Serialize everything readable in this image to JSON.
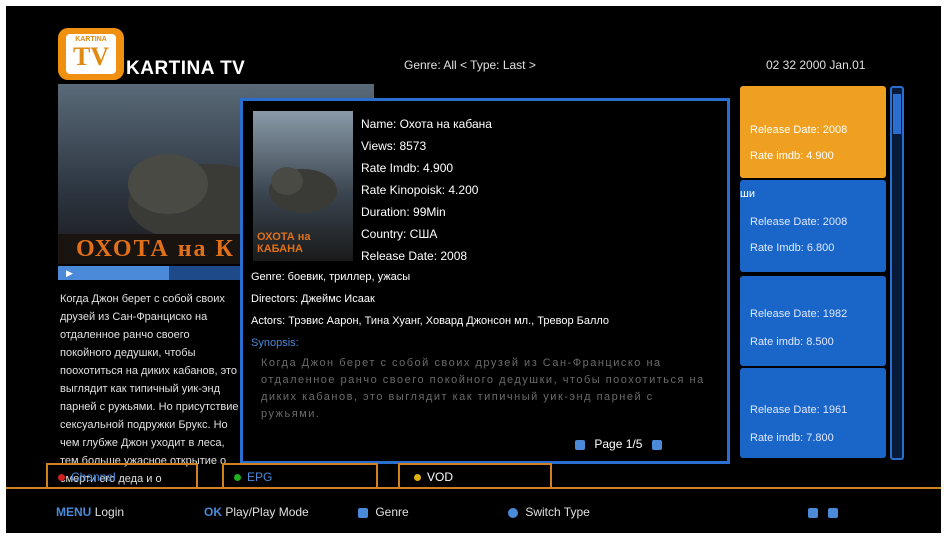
{
  "header": {
    "logo_small": "KARTINA",
    "logo_tv": "TV",
    "brand": "KARTINA TV",
    "filter": "Genre: All < Type: Last >",
    "clock": "02 32  2000 Jan.01"
  },
  "preview": {
    "poster_title": "ОХОТА на К",
    "progress": 0.35,
    "description": "Когда Джон берет с собой своих друзей из Сан-Франциско на отдаленное ранчо своего покойного дедушки, чтобы поохотиться на диких кабанов, это выглядит как типичный уик-энд парней с ружьями. Но присутствие сексуальной подружки Брукс. Но чем глубже Джон уходит в леса, тем больше ужасное открытие о смерти его деда и о"
  },
  "list": [
    {
      "release": "Release Date: 2008",
      "rate": "Rate imdb: 4.900",
      "selected": true,
      "title": ""
    },
    {
      "release": "Release Date: 2008",
      "rate": "Rate Imdb: 6.800",
      "selected": false,
      "title": "ши"
    },
    {
      "release": "Release Date: 1982",
      "rate": "Rate imdb: 8.500",
      "selected": false,
      "title": ""
    },
    {
      "release": "Release Date: 1961",
      "rate": "Rate imdb: 7.800",
      "selected": false,
      "title": ""
    }
  ],
  "modal": {
    "poster_title": "ОХОТА на КАБАНА",
    "name": "Name: Охота на кабана",
    "views": "Views: 8573",
    "rate_imdb": "Rate Imdb: 4.900",
    "rate_kinopoisk": "Rate Kinopoisk: 4.200",
    "duration": "Duration: 99Min",
    "country": "Country: США",
    "release": "Release Date: 2008",
    "genre": "Genre: боевик, триллер, ужасы",
    "directors": "Directors: Джеймс Исаак",
    "actors": "Actors: Трэвис Аарон, Тина Хуанг, Ховард Джонсон мл., Тревор Балло",
    "synopsis_label": "Synopsis:",
    "synopsis": "Когда Джон берет с собой своих друзей из Сан-Франциско на отдаленное ранчо своего покойного дедушки, чтобы поохотиться на диких кабанов, это выглядит как типичный уик-энд парней с ружьями.",
    "page": "Page 1/5"
  },
  "tabs": [
    {
      "label": "Channel",
      "dot": "#d02020"
    },
    {
      "label": "EPG",
      "dot": "#20b020"
    },
    {
      "label": "VOD",
      "dot": "#e0b010"
    }
  ],
  "bottom": {
    "menu_key": "MENU",
    "menu_label": "Login",
    "ok_key": "OK",
    "ok_label": "Play/Play Mode",
    "genre_label": "Genre",
    "switch_label": "Switch Type"
  },
  "colors": {
    "accent_blue": "#2a6ed0",
    "accent_orange": "#f0a020",
    "tab_border": "#d08020"
  }
}
